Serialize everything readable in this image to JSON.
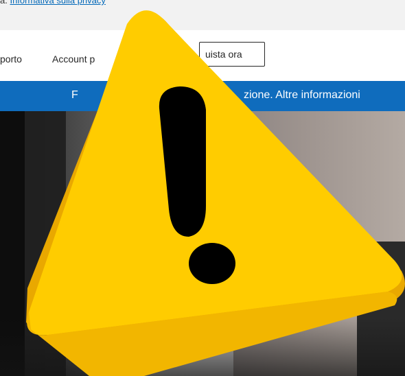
{
  "privacy": {
    "prefix": "a.",
    "link": "Informativa sulla privacy"
  },
  "nav": {
    "support_label": "porto",
    "account_label": "Account p",
    "buy_label": "uista ora"
  },
  "banner": {
    "left_text": "F",
    "right_text": "zione. Altre informazioni"
  },
  "colors": {
    "banner_bg": "#0f6cbd",
    "warning_yellow": "#ffcc00",
    "warning_shadow": "#e6a800"
  },
  "overlay_icon": "warning-triangle-icon"
}
